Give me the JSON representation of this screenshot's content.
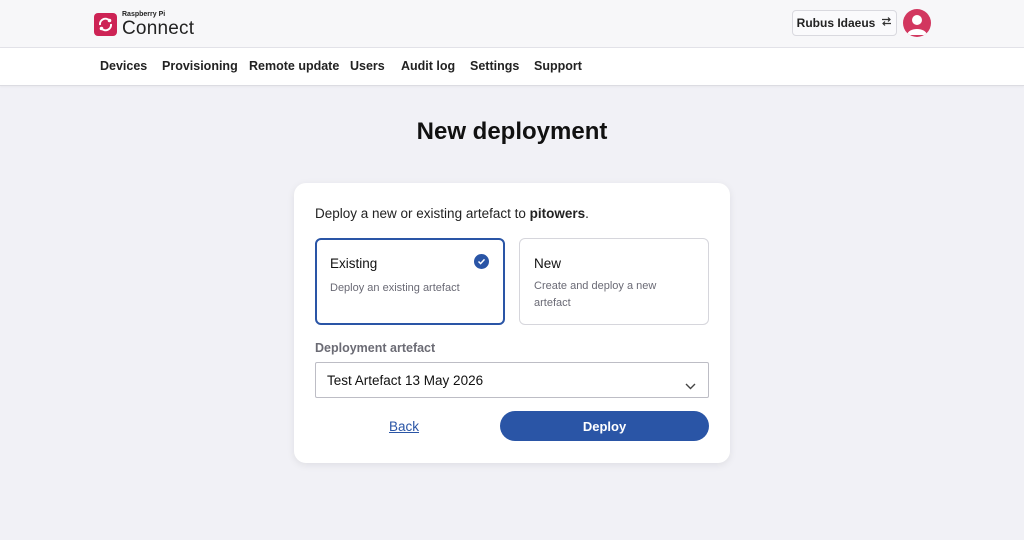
{
  "brand": {
    "small": "Raspberry Pi",
    "big": "Connect",
    "color": "#cd2355"
  },
  "account": {
    "name": "Rubus Idaeus",
    "switch_icon": "switch-arrows-icon",
    "avatar_icon": "user-avatar-icon"
  },
  "nav": {
    "items": [
      {
        "label": "Devices"
      },
      {
        "label": "Provisioning"
      },
      {
        "label": "Remote update"
      },
      {
        "label": "Users"
      },
      {
        "label": "Audit log"
      },
      {
        "label": "Settings"
      },
      {
        "label": "Support"
      }
    ]
  },
  "page": {
    "title": "New deployment"
  },
  "form": {
    "intro_prefix": "Deploy a new or existing artefact to ",
    "target": "pitowers",
    "intro_suffix": ".",
    "options": {
      "existing": {
        "title": "Existing",
        "desc": "Deploy an existing artefact",
        "selected": true
      },
      "new": {
        "title": "New",
        "desc": "Create and deploy a new artefact",
        "selected": false
      }
    },
    "artefact_label": "Deployment artefact",
    "artefact_value": "Test Artefact 13 May 2026",
    "back_label": "Back",
    "deploy_label": "Deploy"
  },
  "colors": {
    "accent": "#2a55a6",
    "background": "#f1f1f6"
  }
}
